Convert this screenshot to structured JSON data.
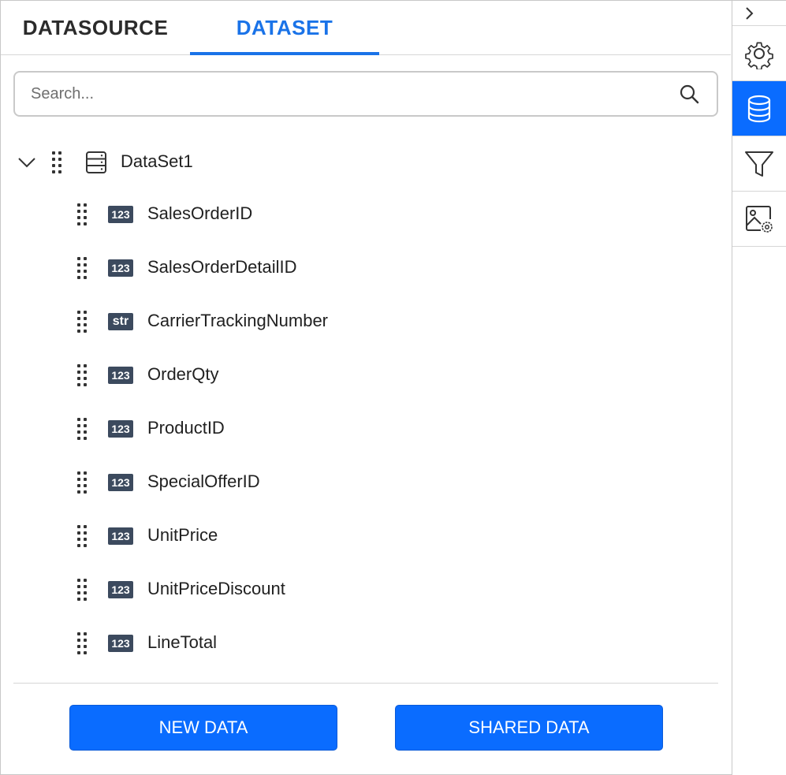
{
  "tabs": {
    "datasource": "DATASOURCE",
    "dataset": "DATASET",
    "active": "dataset",
    "accent_color": "#1a73e8"
  },
  "search": {
    "placeholder": "Search...",
    "value": ""
  },
  "tree": {
    "dataset_name": "DataSet1",
    "expanded": true,
    "fields": [
      {
        "name": "SalesOrderID",
        "type": "123"
      },
      {
        "name": "SalesOrderDetailID",
        "type": "123"
      },
      {
        "name": "CarrierTrackingNumber",
        "type": "str"
      },
      {
        "name": "OrderQty",
        "type": "123"
      },
      {
        "name": "ProductID",
        "type": "123"
      },
      {
        "name": "SpecialOfferID",
        "type": "123"
      },
      {
        "name": "UnitPrice",
        "type": "123"
      },
      {
        "name": "UnitPriceDiscount",
        "type": "123"
      },
      {
        "name": "LineTotal",
        "type": "123"
      }
    ]
  },
  "buttons": {
    "new_data": "NEW DATA",
    "shared_data": "SHARED DATA",
    "color": "#0a6cff"
  },
  "rail": {
    "items": [
      {
        "icon": "chevron-right-icon"
      },
      {
        "icon": "gear-icon"
      },
      {
        "icon": "database-icon",
        "active": true
      },
      {
        "icon": "filter-icon"
      },
      {
        "icon": "image-settings-icon"
      }
    ]
  }
}
